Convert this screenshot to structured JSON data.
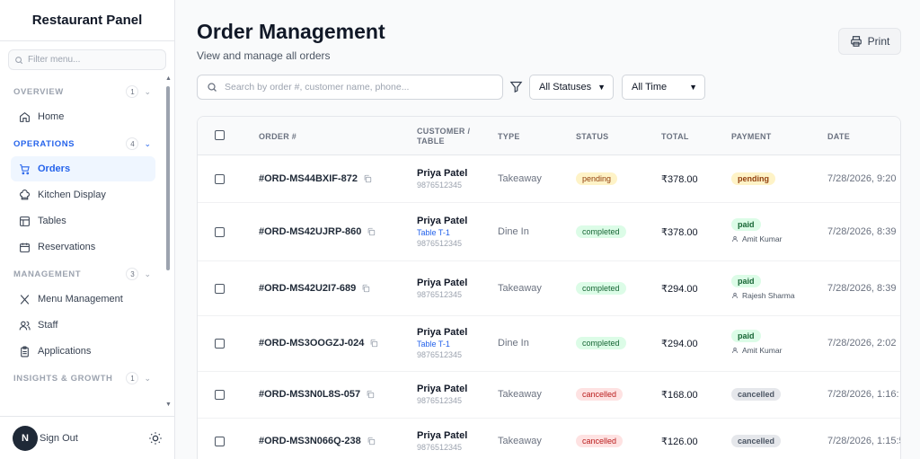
{
  "sidebar": {
    "brand": "Restaurant Panel",
    "filter_placeholder": "Filter menu...",
    "sections": [
      {
        "title": "OVERVIEW",
        "count": "1",
        "items": [
          {
            "label": "Home",
            "icon": "home-icon"
          }
        ]
      },
      {
        "title": "OPERATIONS",
        "count": "4",
        "items": [
          {
            "label": "Orders",
            "icon": "cart-icon"
          },
          {
            "label": "Kitchen Display",
            "icon": "chef-hat-icon"
          },
          {
            "label": "Tables",
            "icon": "table-icon"
          },
          {
            "label": "Reservations",
            "icon": "calendar-icon"
          }
        ]
      },
      {
        "title": "MANAGEMENT",
        "count": "3",
        "items": [
          {
            "label": "Menu Management",
            "icon": "utensils-icon"
          },
          {
            "label": "Staff",
            "icon": "users-icon"
          },
          {
            "label": "Applications",
            "icon": "clipboard-icon"
          }
        ]
      },
      {
        "title": "INSIGHTS & GROWTH",
        "count": "1",
        "items": []
      }
    ],
    "active_item": "Orders",
    "avatar_initial": "N",
    "signout_label": "Sign Out"
  },
  "header": {
    "title": "Order Management",
    "subtitle": "View and manage all orders",
    "print_label": "Print"
  },
  "filters": {
    "search_placeholder": "Search by order #, customer name, phone...",
    "status_selected": "All Statuses",
    "time_selected": "All Time"
  },
  "table": {
    "columns": [
      "ORDER #",
      "CUSTOMER / TABLE",
      "TYPE",
      "STATUS",
      "TOTAL",
      "PAYMENT",
      "DATE"
    ],
    "rows": [
      {
        "order": "#ORD-MS44BXIF-872",
        "customer": "Priya Patel",
        "table": "",
        "phone": "9876512345",
        "type": "Takeaway",
        "status": "pending",
        "total": "₹378.00",
        "payment": "pending",
        "pay_by": "",
        "date": "7/28/2026, 9:20"
      },
      {
        "order": "#ORD-MS42UJRP-860",
        "customer": "Priya Patel",
        "table": "Table T-1",
        "phone": "9876512345",
        "type": "Dine In",
        "status": "completed",
        "total": "₹378.00",
        "payment": "paid",
        "pay_by": "Amit Kumar",
        "date": "7/28/2026, 8:39"
      },
      {
        "order": "#ORD-MS42U2I7-689",
        "customer": "Priya Patel",
        "table": "",
        "phone": "9876512345",
        "type": "Takeaway",
        "status": "completed",
        "total": "₹294.00",
        "payment": "paid",
        "pay_by": "Rajesh Sharma",
        "date": "7/28/2026, 8:39"
      },
      {
        "order": "#ORD-MS3OOGZJ-024",
        "customer": "Priya Patel",
        "table": "Table T-1",
        "phone": "9876512345",
        "type": "Dine In",
        "status": "completed",
        "total": "₹294.00",
        "payment": "paid",
        "pay_by": "Amit Kumar",
        "date": "7/28/2026, 2:02"
      },
      {
        "order": "#ORD-MS3N0L8S-057",
        "customer": "Priya Patel",
        "table": "",
        "phone": "9876512345",
        "type": "Takeaway",
        "status": "cancelled",
        "total": "₹168.00",
        "payment": "cancelled",
        "pay_by": "",
        "date": "7/28/2026, 1:16:"
      },
      {
        "order": "#ORD-MS3N066Q-238",
        "customer": "Priya Patel",
        "table": "",
        "phone": "9876512345",
        "type": "Takeaway",
        "status": "cancelled",
        "total": "₹126.00",
        "payment": "cancelled",
        "pay_by": "",
        "date": "7/28/2026, 1:15:5"
      }
    ]
  },
  "colors": {
    "accent": "#2563eb",
    "pending": "#fef3c7",
    "completed": "#dcfce7",
    "cancelled": "#fee2e2"
  }
}
